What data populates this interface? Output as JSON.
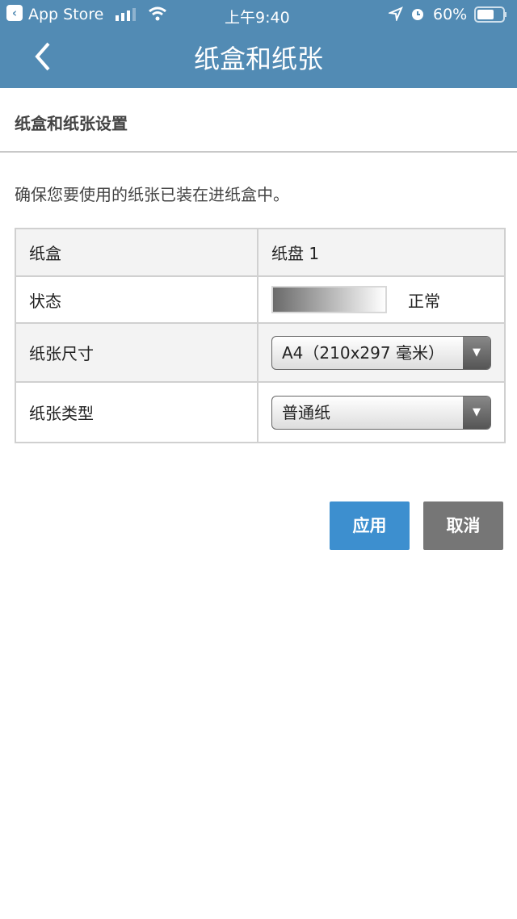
{
  "status_bar": {
    "back_app": "App Store",
    "time": "上午9:40",
    "battery": "60%",
    "icons": [
      "signal-icon",
      "wifi-icon",
      "location-icon",
      "alarm-icon",
      "battery-icon"
    ]
  },
  "header": {
    "title": "纸盒和纸张",
    "back_icon": "chevron-left-icon"
  },
  "section_title": "纸盒和纸张设置",
  "hint": "确保您要使用的纸张已装在进纸盒中。",
  "table": {
    "rows": [
      {
        "label": "纸盒",
        "value": "纸盘 1"
      },
      {
        "label": "状态",
        "value": "正常"
      },
      {
        "label": "纸张尺寸",
        "value": "A4（210x297 毫米）"
      },
      {
        "label": "纸张类型",
        "value": "普通纸"
      }
    ]
  },
  "buttons": {
    "apply": "应用",
    "cancel": "取消"
  },
  "colors": {
    "header": "#528bb4",
    "apply": "#3d8fcf",
    "cancel": "#767676"
  }
}
